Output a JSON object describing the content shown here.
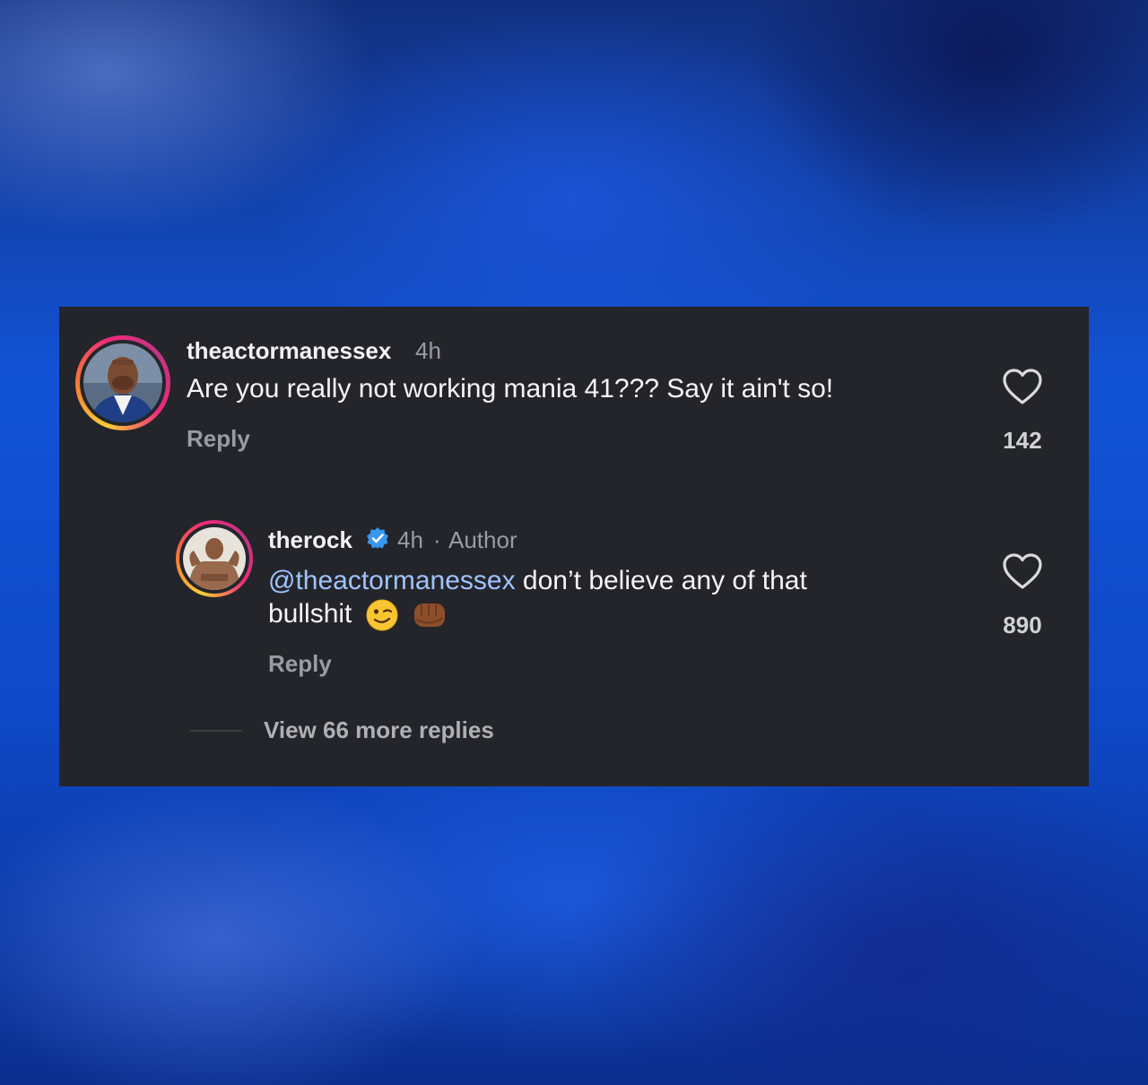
{
  "comments": [
    {
      "username": "theactormanessex",
      "time": "4h",
      "text": "Are you really not working mania 41??? Say it ain't so!",
      "reply_label": "Reply",
      "likes": "142"
    },
    {
      "username": "therock",
      "time": "4h",
      "separator": "·",
      "author_label": "Author",
      "mention": "@theactormanessex",
      "text_line1": " don’t believe any of that",
      "text_line2": "bullshit",
      "reply_label": "Reply",
      "likes": "890"
    }
  ],
  "view_more": "View 66 more replies",
  "colors": {
    "card_bg": "#24252a",
    "mention": "#9fc4ff",
    "verified": "#3897f0"
  },
  "icons": [
    "heart-icon",
    "verified-badge-icon",
    "wink-emoji",
    "fist-emoji"
  ]
}
